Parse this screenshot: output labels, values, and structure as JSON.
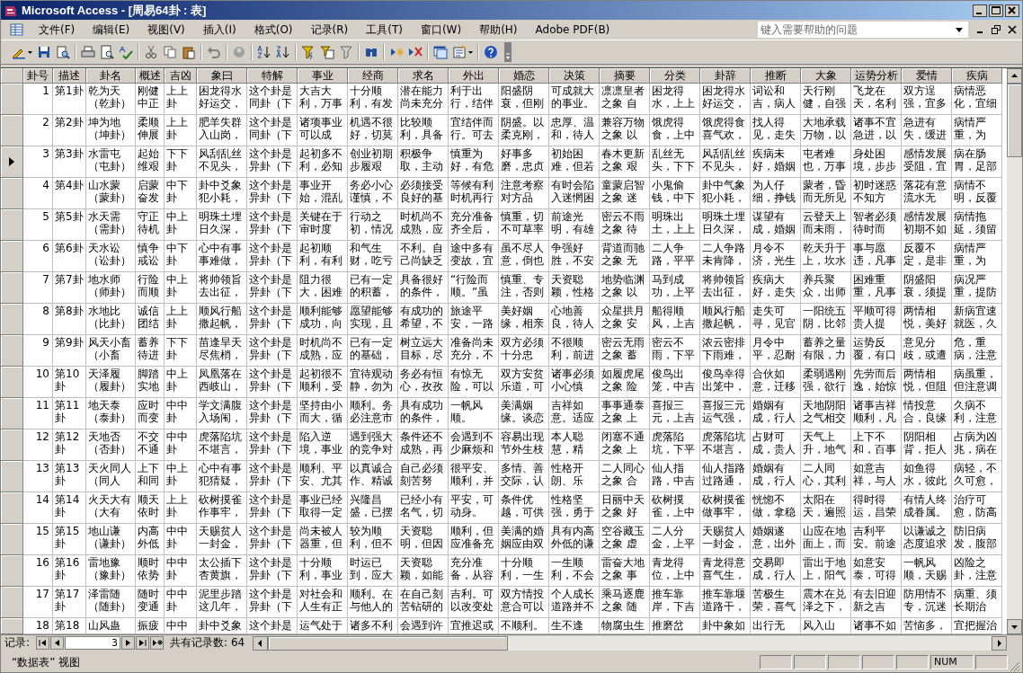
{
  "window": {
    "title": "Microsoft Access - [周易64卦 : 表]"
  },
  "menu": [
    "文件(F)",
    "编辑(E)",
    "视图(V)",
    "插入(I)",
    "格式(O)",
    "记录(R)",
    "工具(T)",
    "窗口(W)",
    "帮助(H)",
    "Adobe PDF(B)"
  ],
  "help_box": {
    "placeholder": "键入需要帮助的问题"
  },
  "table": {
    "columns": [
      "卦号",
      "描述",
      "卦名",
      "概述",
      "吉凶",
      "象曰",
      "特解",
      "事业",
      "经商",
      "求名",
      "外出",
      "婚恋",
      "决策",
      "摘要",
      "分类",
      "卦辞",
      "推断",
      "大象",
      "运势分析",
      "爱情",
      "疾病"
    ],
    "rows": [
      {
        "selected": false,
        "cells": [
          "1",
          "第1卦",
          "乾为天（乾卦）",
          "刚健中正",
          "上上卦",
          "困龙得水好运交，",
          "这个卦是同卦（下",
          "大吉大利，万事",
          "十分顺利，有发",
          "潜在能力尚未充分",
          "利于出行，结伴",
          "阳盛阴衰，但刚",
          "可成就大的事业。",
          "凛凛皇者之象 自",
          "困龙得水，上上",
          "困龙得水好运交，",
          "词讼和吉，病人",
          "天行刚健，自强",
          "飞龙在天，名利",
          "双方逞强，宜多",
          "病情恶化，宜细"
        ]
      },
      {
        "selected": false,
        "cells": [
          "2",
          "第2卦",
          "坤为地（坤卦）",
          "柔顺伸展",
          "上上卦",
          "肥羊失群入山岗，",
          "这个卦是同卦（下",
          "诸项事业可以成",
          "机遇不很好，切莫",
          "比较顺利，具备",
          "宜结伴而行。可去",
          "阴盛。以柔克刚，",
          "忠厚、温和，待人",
          "兼容万物之象 以",
          "饿虎得食，上中",
          "饿虎得食喜气欢，",
          "找人得见，走失",
          "大地承载万物，以",
          "诸事不宜急进，以",
          "急进有失，缓进",
          "病情严重，为"
        ]
      },
      {
        "selected": true,
        "cells": [
          "3",
          "第3卦",
          "水雷屯（屯卦）",
          "起始维艰",
          "下下卦",
          "风刮乱丝不见头，",
          "这个卦是异卦（下",
          "起初多不利，必知",
          "创业初期步履艰",
          "积极争取，主动",
          "慎重为好，有危",
          "好事多磨，忠贞",
          "初始困难，但若",
          "春木更新之象 艰",
          "乱丝无头，下下",
          "风刮乱丝不见头，",
          "疾病未好，婚姻",
          "屯者难也，万事",
          "身处困境，步步",
          "感情发展受阻，宜",
          "病在肠胃，足部"
        ]
      },
      {
        "selected": false,
        "cells": [
          "4",
          "第4卦",
          "山水蒙（蒙卦）",
          "启蒙奋发",
          "中下卦",
          "卦中爻象犯小耗，",
          "这个卦是异卦（下",
          "事业开始，混乱",
          "务必小心谨慎，不",
          "必须接受良好的基",
          "等候有利时机再行",
          "注意考察对方品",
          "有时会陷入迷惘困",
          "童蒙启智之象 迷",
          "小鬼偷钱，中下",
          "卦中气象犯小耗，",
          "为人仔细，挣钱",
          "蒙者，昏而无所见",
          "初时迷惑不知方",
          "落花有意流水无",
          "病情不明，反覆"
        ]
      },
      {
        "selected": false,
        "cells": [
          "5",
          "第5卦",
          "水天需（需卦）",
          "守正待机",
          "中上卦",
          "明珠土埋日久深，",
          "这个卦是异卦（下",
          "关键在于审时度",
          "行动之初，情况",
          "时机尚不成熟，应",
          "充分准备齐全后，",
          "慎重，切不可草率",
          "前途光明，有雄",
          "密云不雨之象 待",
          "明珠出土，上上",
          "明珠土埋日久深，",
          "谋望有成，婚姻",
          "云登天上而未雨，",
          "智者必须待时而",
          "感情发展初期不如",
          "病情拖延，须留"
        ]
      },
      {
        "selected": false,
        "cells": [
          "6",
          "第6卦",
          "天水讼（讼卦）",
          "慎争戒讼",
          "中下卦",
          "心中有事事难做，",
          "这个卦是异卦（下",
          "起初顺利，有利",
          "和气生财，吃亏",
          "不利。自己尚缺乏",
          "途中多有变故，宜",
          "虽不尽人意，倒也",
          "争强好胜，不安",
          "背道而驰之象 无",
          "二人争路，平平",
          "二人争路未肯降，",
          "月令不济，光生",
          "乾天升于上，坎水",
          "事与愿违，凡事",
          "反覆不定，是非",
          "病情严重，为"
        ]
      },
      {
        "selected": false,
        "cells": [
          "7",
          "第7卦",
          "地水师（师卦）",
          "行险而顺",
          "中上卦",
          "将帅领旨去出征，",
          "这个卦是异卦（下",
          "阻力很大，困难",
          "已有一定的积蓄，",
          "具备很好的条件，",
          "“行险而顺。”虽",
          "慎重、专注，否则",
          "天资聪颖，性格",
          "地势临渊之象 以",
          "马到成功，上平",
          "将帅领旨去出征，",
          "疾病大好，走失",
          "养兵聚众，出师",
          "困难重重，凡事",
          "阴盛阳衰，须提",
          "病况严重，提防"
        ]
      },
      {
        "selected": false,
        "cells": [
          "8",
          "第8卦",
          "水地比（比卦）",
          "诚信团结",
          "上上卦",
          "顺风行船撒起帆，",
          "这个卦是异卦（下",
          "顺利能够成功，向",
          "愿望能够实现，且",
          "有成功的希望，不",
          "旅途平安，一路",
          "美好姻缘，相亲",
          "心地善良，待人",
          "众星拱月之象 安",
          "船得顺风，上吉",
          "顺风行船撒起帆，",
          "走失可寻，见官",
          "一阳统五阴，比邻",
          "平顺可得贵人提",
          "两情相悦，美好",
          "新病宜速就医，久"
        ]
      },
      {
        "selected": false,
        "cells": [
          "9",
          "第9卦",
          "风天小畜（小畜",
          "蓄养待进",
          "下下卦",
          "苗逢旱天尽焦梢，",
          "这个卦是异卦（下",
          "时机尚不成熟，应",
          "已有一定的基础，",
          "树立远大目标，尽",
          "准备尚未充分，不",
          "双方必须十分忠",
          "不很顺利，前进",
          "密云无雨之象 蓄",
          "密云不雨，下平",
          "浓云密排下雨难，",
          "月令中平，忍耐",
          "蓄养之量有限，力",
          "运势反覆，有口",
          "意见分歧，或遭",
          "危，重病，注意"
        ]
      },
      {
        "selected": false,
        "cells": [
          "10",
          "第10卦",
          "天泽履（履卦）",
          "脚踏实地",
          "中上卦",
          "凤凰落在西岐山，",
          "这个卦是异卦（下",
          "起初很不顺利，受",
          "宜待观动静，勿为",
          "务必有恒心，孜孜",
          "有惊无险，可以",
          "双方安贫乐道，可",
          "诸事必须小心慎",
          "如履虎尾之象 险",
          "俊鸟出笼，中吉",
          "俊鸟幸得出笼中，",
          "合伙如意，迁移",
          "柔弱遇刚强，欲行",
          "先劳而后逸，始惊",
          "两情相悦，但阻",
          "病虽重，但注意调"
        ]
      },
      {
        "selected": false,
        "cells": [
          "11",
          "第11卦",
          "地天泰（泰卦）",
          "应时而变",
          "中中卦",
          "学文满腹入场闱，",
          "这个卦是异卦（下",
          "坚持由小而大，循",
          "顺利。务必注意市",
          "具有成功的条件，",
          "一帆风顺。",
          "美满姻缘。谈恋",
          "吉祥如意。适应",
          "事事通泰之象 上",
          "喜报三元，上吉",
          "喜报三元运气强，",
          "婚姻有成，行人",
          "天地阴阳之气相交",
          "诸事吉祥顺利，凡",
          "情投意合，良缘",
          "久病不利，注意"
        ]
      },
      {
        "selected": false,
        "cells": [
          "12",
          "第12卦",
          "天地否（否卦）",
          "不交不通",
          "中中卦",
          "虎落陷坑不堪言，",
          "这个卦是异卦（下",
          "陷入逆境，事业",
          "遇到强大的竞争对",
          "条件还不成熟，再",
          "会遇到不少麻烦和",
          "容易出现节外生枝",
          "本人聪慧，精",
          "闭塞不通之象 上",
          "虎落陷坑，下平",
          "虎落陷坑不堪言，",
          "占财可成，贵人",
          "天气上升，地气",
          "上下不和，百事",
          "阴阳相背，拒人",
          "占病为凶兆，病在"
        ]
      },
      {
        "selected": false,
        "cells": [
          "13",
          "第13卦",
          "天火同人（同人",
          "上下和同",
          "中上卦",
          "心中有事犯猜疑，",
          "这个卦是异卦（下",
          "顺利、平安、尤其",
          "以真诚合作、精诚",
          "自己必须刻苦努",
          "很平安、顺利，并",
          "多情、善交际，认",
          "性格开朗、乐",
          "二人同心之象 合",
          "仙人指路，中吉",
          "仙人指路过路通，",
          "婚姻有成，行人",
          "二人同心，其利",
          "如意吉祥，与人",
          "如鱼得水，彼此",
          "病轻，不久可愈，"
        ]
      },
      {
        "selected": false,
        "cells": [
          "14",
          "第14卦",
          "火天大有（大有",
          "顺天依时",
          "上上卦",
          "砍树摸雀作事牢，",
          "这个卦是异卦（下",
          "事业已经取得一定",
          "兴隆昌盛，已摆",
          "已经小有名气，切",
          "平安，可动身。",
          "条件优越，可供",
          "性格坚强，勇于",
          "日丽中天之象 好",
          "砍树摸雀，上中",
          "砍树摸雀做事牢，",
          "恍惚不做，拿稳",
          "太阳在天，遍照",
          "得时得运，昌荣",
          "有情人终成眷属。",
          "治疗可愈，防高"
        ]
      },
      {
        "selected": false,
        "cells": [
          "15",
          "第15卦",
          "地山谦（谦卦）",
          "内高外低",
          "中中卦",
          "天赐贫人一封金，",
          "这个卦是异卦（下",
          "尚未被人器重，但",
          "较为顺利，但不",
          "天资聪明，但因",
          "顺利，但应准备充",
          "美满的婚姻应由双",
          "具有内高外低的谦",
          "空谷藏玉之象 虚",
          "二人分金，上平",
          "天赐贫人一封金，",
          "婚姻遂意，出外",
          "山应在地面上，而",
          "吉利平安。前途",
          "以谦诚之态度追求",
          "防旧病发，腹部"
        ]
      },
      {
        "selected": false,
        "cells": [
          "16",
          "第16卦",
          "雷地豫（豫卦）",
          "顺时依势",
          "中中卦",
          "太公插下杏黄旗，",
          "这个卦是异卦（下",
          "十分顺利，事业",
          "时运已到，应大",
          "天资聪颖，如能",
          "充分准备，从容",
          "十分顺利，一生",
          "一生顺利，不会",
          "雷奋大地之象 事",
          "青龙得位，上中",
          "青龙得意喜气生，",
          "交易即成，行人",
          "雷出于地上，阳气",
          "如意安泰，可得",
          "一帆风顺，天赐",
          "凶险之卦，注意"
        ]
      },
      {
        "selected": false,
        "cells": [
          "17",
          "第17卦",
          "泽雷随（随卦）",
          "随时变通",
          "中中卦",
          "泥里步踏这几年，",
          "这个卦是异卦（下",
          "对社会和人生有正",
          "顺利。在与他人的",
          "在自己刻苦钻研的",
          "吉利。可以改变处",
          "双方情投意合可以",
          "个人成长道路并不",
          "乘马逐鹿之象 随",
          "推车靠岸，下吉",
          "推车靠堰道路干，",
          "苦极生荣，喜气",
          "震木在兑泽之下，",
          "有去旧迎新之吉",
          "防用情不专，沉迷",
          "病重、须长期治"
        ]
      },
      {
        "selected": false,
        "cells": [
          "18",
          "第18",
          "山风蛊",
          "振疲",
          "中中",
          "卦中爻象",
          "这个卦是",
          "运气处于",
          "诸多不利",
          "会遇到许",
          "宜推迟或",
          "不顺利。",
          "生不逢",
          "物腐虫生",
          "推磨岔",
          "卦中象如",
          "出行无",
          "风入山",
          "诸事不如",
          "苦恼多，",
          "宜把握治"
        ]
      }
    ]
  },
  "record_navigator": {
    "label": "记录:",
    "current": "3",
    "total": "共有记录数: 64"
  },
  "status_bar": {
    "view": "“数据表” 视图",
    "indicators": [
      "NUM"
    ]
  }
}
